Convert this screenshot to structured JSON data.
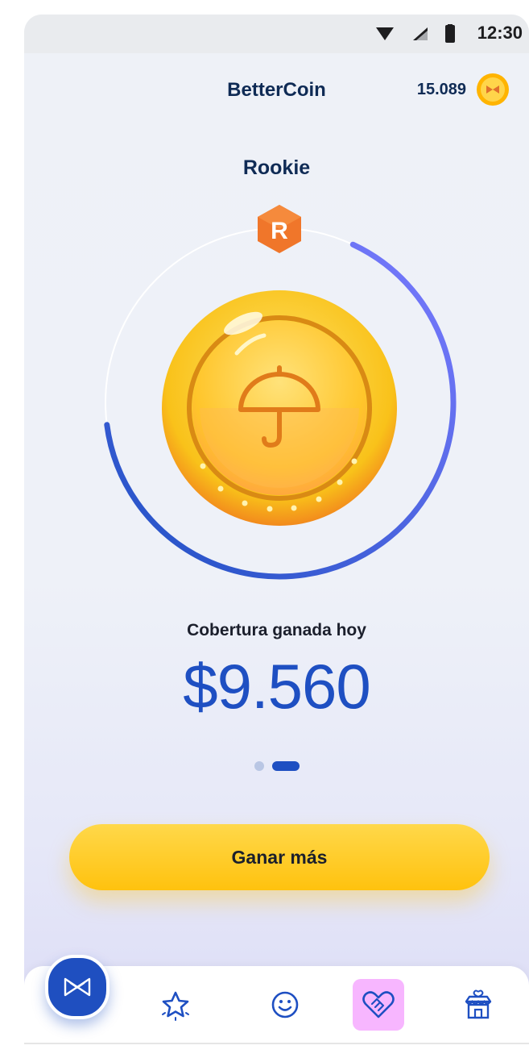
{
  "status_bar": {
    "time": "12:30"
  },
  "header": {
    "title": "BetterCoin",
    "balance": "15.089"
  },
  "level": {
    "name": "Rookie",
    "badge_letter": "R",
    "progress": 0.66
  },
  "earned": {
    "label": "Cobertura ganada hoy",
    "amount": "$9.560"
  },
  "pager": {
    "total": 2,
    "active": 2
  },
  "cta": {
    "label": "Ganar más"
  },
  "bottom_nav": {
    "items": [
      {
        "icon": "brand-logo-icon",
        "active": false
      },
      {
        "icon": "star-icon",
        "active": false
      },
      {
        "icon": "smiley-icon",
        "active": false
      },
      {
        "icon": "handshake-heart-icon",
        "active": true
      },
      {
        "icon": "store-icon",
        "active": false
      }
    ]
  },
  "colors": {
    "primary": "#1e4fc2",
    "accent_yellow": "#ffc20e",
    "active_nav": "#f7b6ff",
    "badge_orange": "#f0762a",
    "text_dark": "#0f2b55"
  }
}
